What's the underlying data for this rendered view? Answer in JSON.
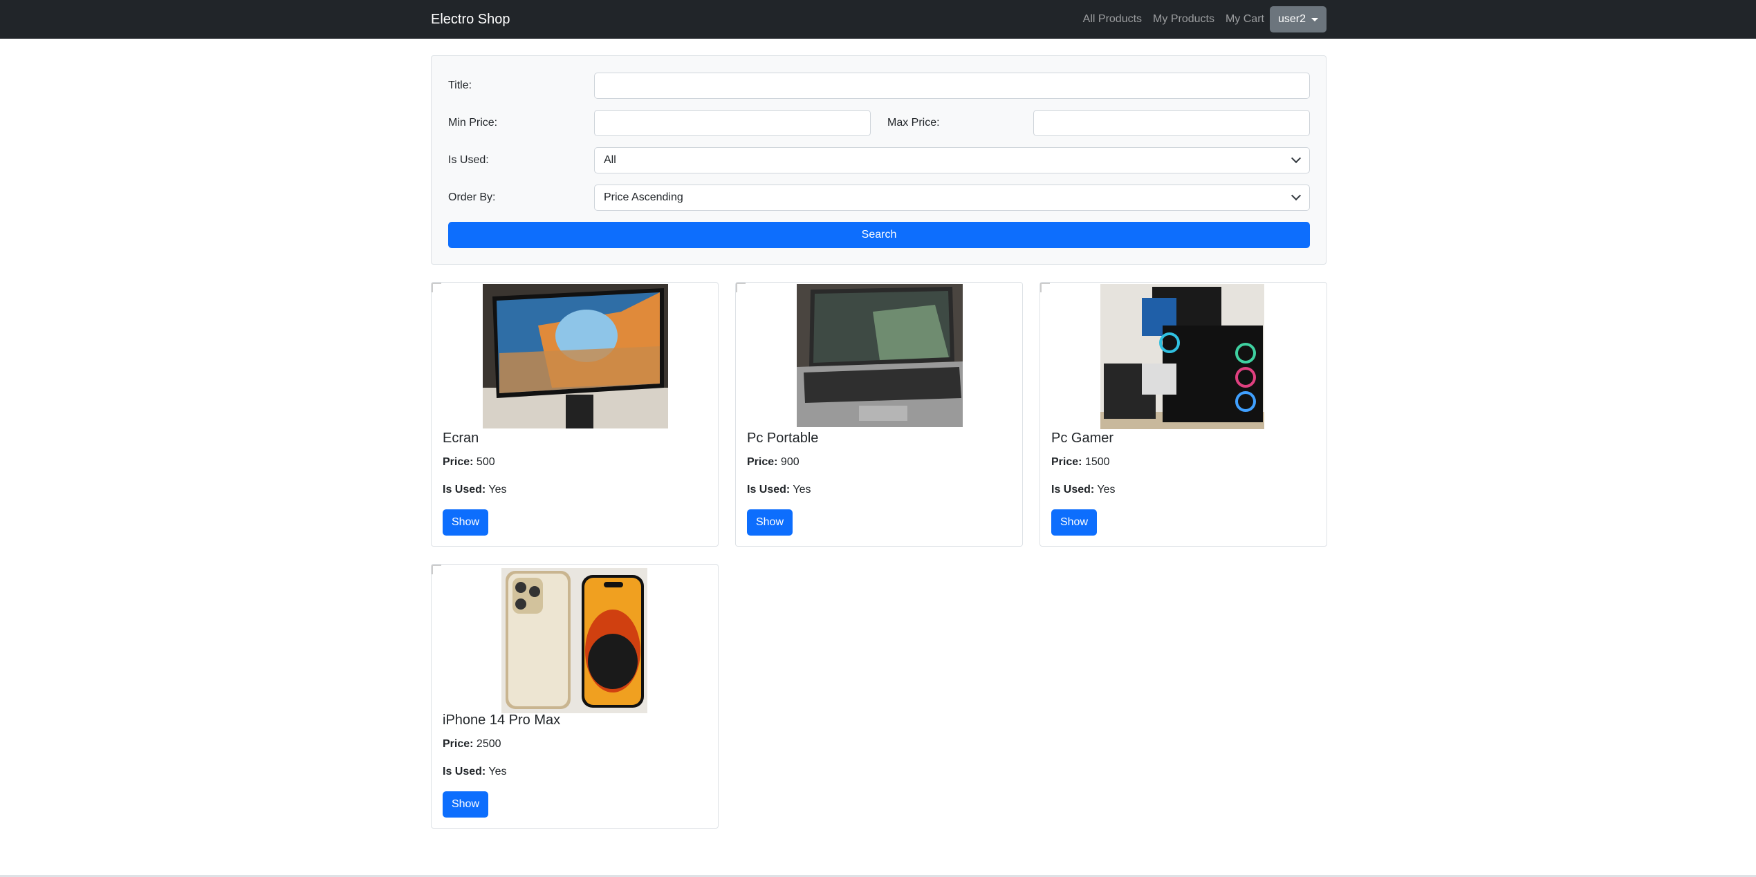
{
  "navbar": {
    "brand": "Electro Shop",
    "links": [
      "All Products",
      "My Products",
      "My Cart"
    ],
    "user": "user2"
  },
  "filters": {
    "title_label": "Title:",
    "title_value": "",
    "min_price_label": "Min Price:",
    "min_price_value": "",
    "max_price_label": "Max Price:",
    "max_price_value": "",
    "is_used_label": "Is Used:",
    "is_used_selected": "All",
    "order_by_label": "Order By:",
    "order_by_selected": "Price Ascending",
    "search_label": "Search"
  },
  "products": [
    {
      "name": "Ecran",
      "price_label": "Price:",
      "price": "500",
      "used_label": "Is Used:",
      "used": "Yes",
      "button": "Show"
    },
    {
      "name": "Pc Portable",
      "price_label": "Price:",
      "price": "900",
      "used_label": "Is Used:",
      "used": "Yes",
      "button": "Show"
    },
    {
      "name": "Pc Gamer",
      "price_label": "Price:",
      "price": "1500",
      "used_label": "Is Used:",
      "used": "Yes",
      "button": "Show"
    },
    {
      "name": "iPhone 14 Pro Max",
      "price_label": "Price:",
      "price": "2500",
      "used_label": "Is Used:",
      "used": "Yes",
      "button": "Show"
    }
  ],
  "colors": {
    "navbar_bg": "#212529",
    "primary": "#0d6efd",
    "user_button": "#6c757d",
    "form_bg": "#f8f9fa"
  }
}
